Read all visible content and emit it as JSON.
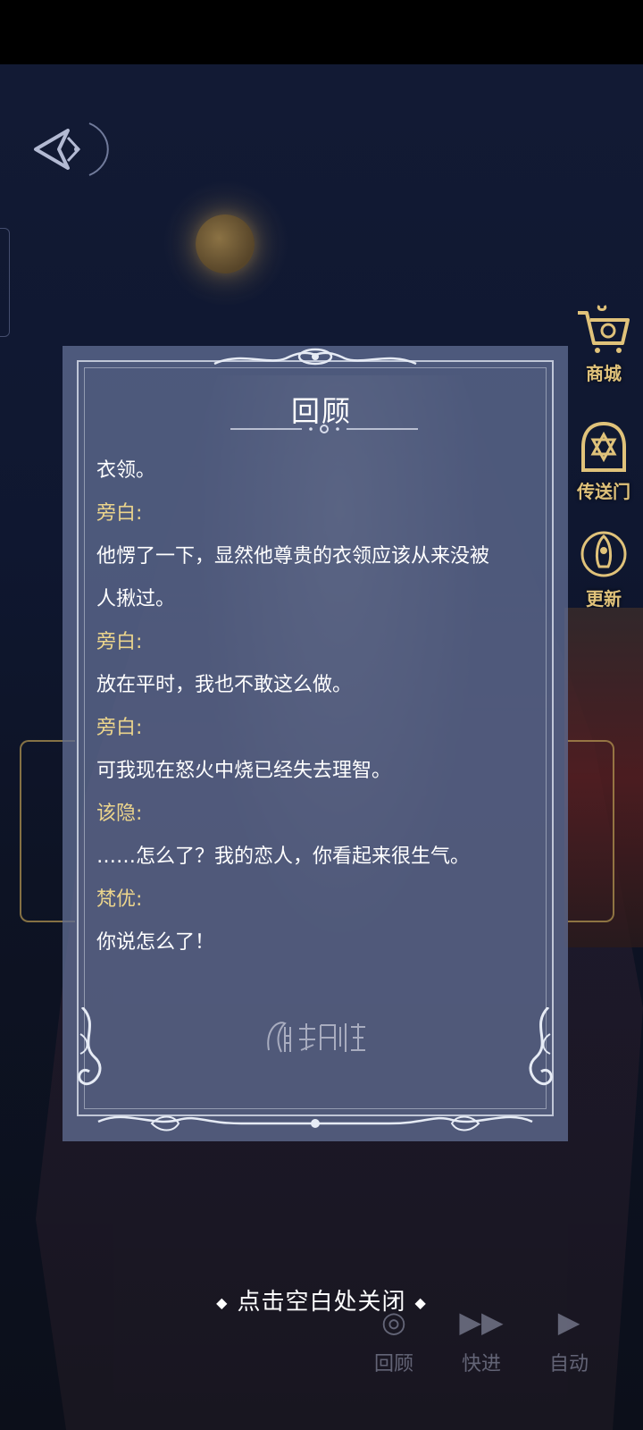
{
  "review": {
    "title": "回顾",
    "watermark": "月影别墅",
    "entries": [
      {
        "type": "text",
        "content": "衣领。"
      },
      {
        "type": "speaker",
        "content": "旁白:"
      },
      {
        "type": "text",
        "content": "他愣了一下，显然他尊贵的衣领应该从来没被"
      },
      {
        "type": "text",
        "content": "人揪过。"
      },
      {
        "type": "speaker",
        "content": "旁白:"
      },
      {
        "type": "text",
        "content": "放在平时，我也不敢这么做。"
      },
      {
        "type": "speaker",
        "content": "旁白:"
      },
      {
        "type": "text",
        "content": "可我现在怒火中烧已经失去理智。"
      },
      {
        "type": "speaker",
        "content": "该隐:"
      },
      {
        "type": "text",
        "content": "……怎么了？我的恋人，你看起来很生气。"
      },
      {
        "type": "speaker",
        "content": "梵优:"
      },
      {
        "type": "text",
        "content": "你说怎么了！"
      }
    ]
  },
  "close_hint": "点击空白处关闭",
  "side_menu": [
    {
      "label": "商城",
      "icon": "shop-cart-icon"
    },
    {
      "label": "传送门",
      "icon": "portal-hexagram-icon"
    },
    {
      "label": "更新",
      "icon": "rocket-update-icon"
    }
  ],
  "controls": [
    {
      "label": "回顾",
      "icon": "review-icon"
    },
    {
      "label": "快进",
      "icon": "fast-forward-icon"
    },
    {
      "label": "自动",
      "icon": "play-auto-icon"
    }
  ],
  "colors": {
    "speaker": "#ecd58c",
    "text": "#ffffff",
    "panel": "#5f6c91",
    "gold": "#e0c27a"
  }
}
